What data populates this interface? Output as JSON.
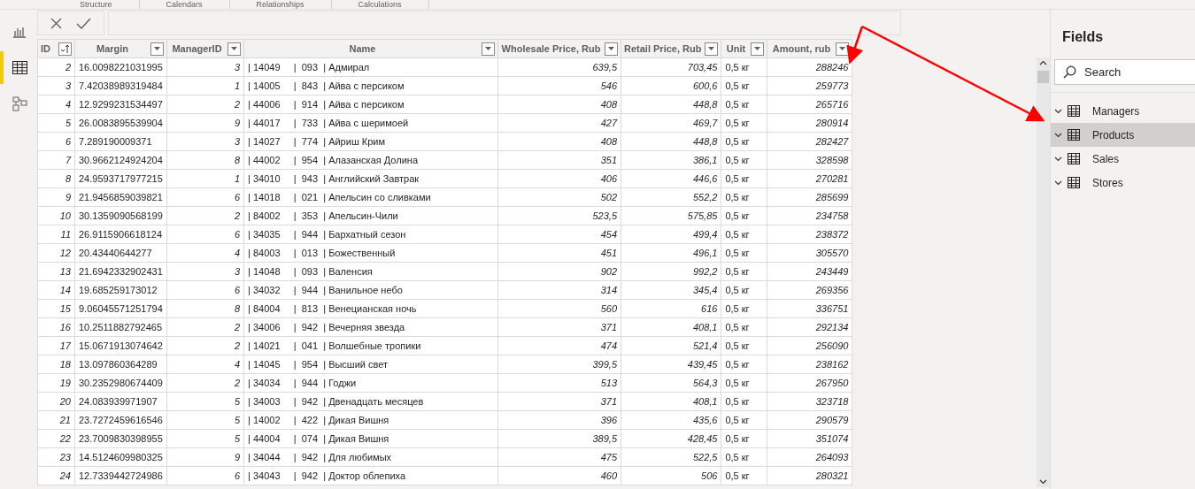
{
  "ribbon": {
    "groups": [
      "Structure",
      "Calendars",
      "Relationships",
      "Calculations"
    ]
  },
  "rail": [
    {
      "kind": "report",
      "selected": false
    },
    {
      "kind": "data",
      "selected": true
    },
    {
      "kind": "model",
      "selected": false
    }
  ],
  "table": {
    "columns": [
      {
        "label": "ID",
        "kind": "number",
        "sorted": true
      },
      {
        "label": "Margin",
        "kind": "text",
        "sorted": false
      },
      {
        "label": "ManagerID",
        "kind": "number",
        "sorted": false
      },
      {
        "label": "Name",
        "kind": "text",
        "sorted": false
      },
      {
        "label": "Wholesale Price, Rub",
        "kind": "number",
        "sorted": false
      },
      {
        "label": "Retail Price, Rub",
        "kind": "number",
        "sorted": false
      },
      {
        "label": "Unit",
        "kind": "text",
        "sorted": false
      },
      {
        "label": "Amount, rub",
        "kind": "number",
        "sorted": false
      }
    ],
    "rows": [
      [
        "2",
        "16.0098221031995",
        "3",
        "| 14049     |  093  | Адмирал",
        "639,5",
        "703,45",
        "0,5 кг",
        "288246"
      ],
      [
        "3",
        "7.42038989319484",
        "1",
        "| 14005     |  843  | Айва с персиком",
        "546",
        "600,6",
        "0,5 кг",
        "259773"
      ],
      [
        "4",
        "12.9299231534497",
        "2",
        "| 44006     |  914  | Айва с персиком",
        "408",
        "448,8",
        "0,5 кг",
        "265716"
      ],
      [
        "5",
        "26.0083895539904",
        "9",
        "| 44017     |  733  | Айва с шеримоей",
        "427",
        "469,7",
        "0,5 кг",
        "280914"
      ],
      [
        "6",
        "7.289190009371",
        "3",
        "| 14027     |  774  | Айриш Крим",
        "408",
        "448,8",
        "0,5 кг",
        "282427"
      ],
      [
        "7",
        "30.9662124924204",
        "8",
        "| 44002     |  954  | Алазанская Долина",
        "351",
        "386,1",
        "0,5 кг",
        "328598"
      ],
      [
        "8",
        "24.9593717977215",
        "1",
        "| 34010     |  943  | Английский Завтрак",
        "406",
        "446,6",
        "0,5 кг",
        "270281"
      ],
      [
        "9",
        "21.9456859039821",
        "6",
        "| 14018     |  021  | Апельсин со сливками",
        "502",
        "552,2",
        "0,5 кг",
        "285699"
      ],
      [
        "10",
        "30.1359090568199",
        "2",
        "| 84002     |  353  | Апельсин-Чили",
        "523,5",
        "575,85",
        "0,5 кг",
        "234758"
      ],
      [
        "11",
        "26.9115906618124",
        "6",
        "| 34035     |  944  | Бархатный сезон",
        "454",
        "499,4",
        "0,5 кг",
        "238372"
      ],
      [
        "12",
        "20.43440644277",
        "4",
        "| 84003     |  013  | Божественный",
        "451",
        "496,1",
        "0,5 кг",
        "305570"
      ],
      [
        "13",
        "21.6942332902431",
        "3",
        "| 14048     |  093  | Валенсия",
        "902",
        "992,2",
        "0,5 кг",
        "243449"
      ],
      [
        "14",
        "19.685259173012",
        "6",
        "| 34032     |  944  | Ванильное небо",
        "314",
        "345,4",
        "0,5 кг",
        "269356"
      ],
      [
        "15",
        "9.06045571251794",
        "8",
        "| 84004     |  813  | Венецианская ночь",
        "560",
        "616",
        "0,5 кг",
        "336751"
      ],
      [
        "16",
        "10.2511882792465",
        "2",
        "| 34006     |  942  | Вечерняя звезда",
        "371",
        "408,1",
        "0,5 кг",
        "292134"
      ],
      [
        "17",
        "15.0671913074642",
        "2",
        "| 14021     |  041  | Волшебные тропики",
        "474",
        "521,4",
        "0,5 кг",
        "256090"
      ],
      [
        "18",
        "13.097860364289",
        "4",
        "| 14045     |  954  | Высший свет",
        "399,5",
        "439,45",
        "0,5 кг",
        "238162"
      ],
      [
        "19",
        "30.2352980674409",
        "2",
        "| 34034     |  944  | Годжи",
        "513",
        "564,3",
        "0,5 кг",
        "267950"
      ],
      [
        "20",
        "24.083939971907",
        "5",
        "| 34003     |  942  | Двенадцать месяцев",
        "371",
        "408,1",
        "0,5 кг",
        "323718"
      ],
      [
        "21",
        "23.7272459616546",
        "5",
        "| 14002     |  422  | Дикая Вишня",
        "396",
        "435,6",
        "0,5 кг",
        "290579"
      ],
      [
        "22",
        "23.7009830398955",
        "5",
        "| 44004     |  074  | Дикая Вишня",
        "389,5",
        "428,45",
        "0,5 кг",
        "351074"
      ],
      [
        "23",
        "14.5124609980325",
        "9",
        "| 34044     |  942  | Для любимых",
        "475",
        "522,5",
        "0,5 кг",
        "264093"
      ],
      [
        "24",
        "12.7339442724986",
        "6",
        "| 34043     |  942  | Доктор облепиха",
        "460",
        "506",
        "0,5 кг",
        "280321"
      ]
    ]
  },
  "fields": {
    "title": "Fields",
    "search": {
      "placeholder": "Search"
    },
    "items": [
      {
        "label": "Managers",
        "selected": false
      },
      {
        "label": "Products",
        "selected": true
      },
      {
        "label": "Sales",
        "selected": false
      },
      {
        "label": "Stores",
        "selected": false
      }
    ]
  }
}
